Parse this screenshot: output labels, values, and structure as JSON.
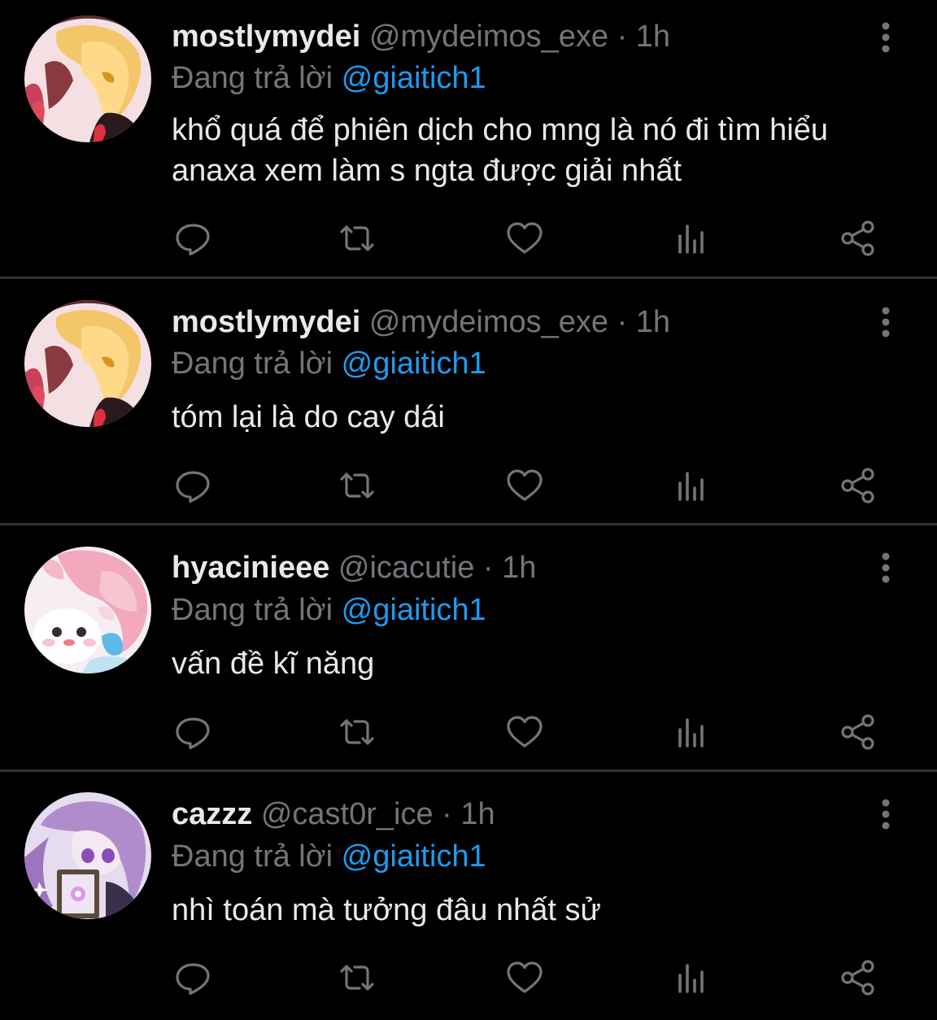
{
  "reply_prefix": "Đang trả lời",
  "colors": {
    "background": "#000000",
    "primary_text": "#e7e9ea",
    "secondary_text": "#71767b",
    "link": "#1d9bf0",
    "divider": "#2f3336"
  },
  "tweets": [
    {
      "display_name": "mostlymydei",
      "handle": "@mydeimos_exe",
      "separator": "·",
      "time": "1h",
      "reply_to": "@giaitich1",
      "text": "khổ quá để phiên dịch cho mng là nó đi tìm hiểu anaxa xem làm s ngta được giải nhất",
      "avatar": "mydei-avatar"
    },
    {
      "display_name": "mostlymydei",
      "handle": "@mydeimos_exe",
      "separator": "·",
      "time": "1h",
      "reply_to": "@giaitich1",
      "text": "tóm lại là do cay dái",
      "avatar": "mydei-avatar"
    },
    {
      "display_name": "hyacinieee",
      "handle": "@icacutie",
      "separator": "·",
      "time": "1h",
      "reply_to": "@giaitich1",
      "text": "vấn đề kĩ năng",
      "avatar": "hyacine-avatar"
    },
    {
      "display_name": "cazzz",
      "handle": "@cast0r_ice",
      "separator": "·",
      "time": "1h",
      "reply_to": "@giaitich1",
      "text": "nhì toán mà tưởng đâu nhất sử",
      "avatar": "castorice-avatar"
    }
  ],
  "action_icons": [
    "reply-icon",
    "retweet-icon",
    "like-icon",
    "views-icon",
    "share-icon"
  ]
}
